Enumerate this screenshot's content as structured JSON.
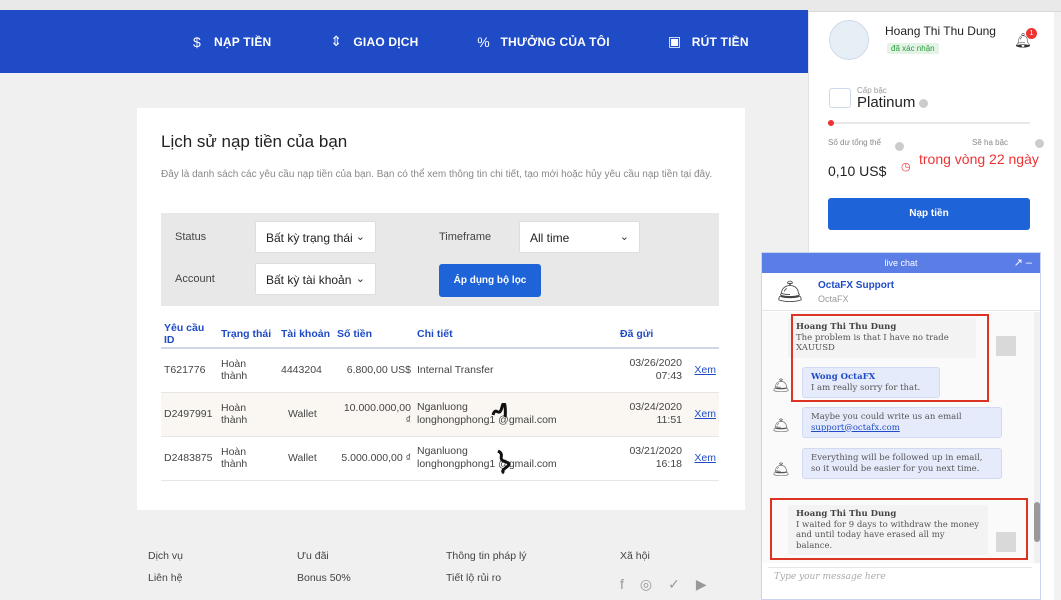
{
  "nav": {
    "items": [
      {
        "icon": "dollar-icon",
        "glyph": "$",
        "label": "NẠP TIỀN"
      },
      {
        "icon": "exchange-icon",
        "glyph": "⇕",
        "label": "GIAO DỊCH"
      },
      {
        "icon": "percent-icon",
        "glyph": "%",
        "label": "THƯỞNG CỦA TÔI"
      },
      {
        "icon": "withdraw-icon",
        "glyph": "▣",
        "label": "RÚT TIỀN"
      }
    ]
  },
  "history": {
    "title": "Lịch sử nạp tiền của bạn",
    "description": "Đây là danh sách các yêu cầu nạp tiền của bạn. Bạn có thể xem thông tin chi tiết, tạo mới hoặc hủy yêu cầu nạp tiền tại đây.",
    "filters": {
      "status_label": "Status",
      "status_value": "Bất kỳ trạng thái",
      "timeframe_label": "Timeframe",
      "timeframe_value": "All time",
      "account_label": "Account",
      "account_value": "Bất kỳ tài khoản",
      "apply_label": "Áp dụng bộ lọc"
    },
    "columns": [
      "Yêu cầu ID",
      "Trạng thái",
      "Tài khoản",
      "Số tiền",
      "Chi tiết",
      "Đã gửi"
    ],
    "rows": [
      {
        "id": "T621776",
        "status": "Hoàn thành",
        "account": "4443204",
        "amount": "6.800,00 US$",
        "detail1": "Internal Transfer",
        "detail2": "",
        "date": "03/26/2020",
        "time": "07:43",
        "action": "Xem"
      },
      {
        "id": "D2497991",
        "status": "Hoàn thành",
        "account": "Wallet",
        "amount": "10.000.000,00 ₫",
        "detail1": "Nganluong",
        "detail2": "longhongphong1  @gmail.com",
        "date": "03/24/2020",
        "time": "11:51",
        "action": "Xem"
      },
      {
        "id": "D2483875",
        "status": "Hoàn thành",
        "account": "Wallet",
        "amount": "5.000.000,00 ₫",
        "detail1": "Nganluong",
        "detail2": "longhongphong1  @gmail.com",
        "date": "03/21/2020",
        "time": "16:18",
        "action": "Xem"
      }
    ]
  },
  "footer": {
    "col1": [
      "Dịch vụ",
      "Liên hệ"
    ],
    "col2": [
      "Ưu đãi",
      "Bonus 50%"
    ],
    "col3": [
      "Thông tin pháp lý",
      "Tiết lộ rủi ro"
    ],
    "col4": [
      "Xã hội"
    ]
  },
  "profile": {
    "name": "Hoang Thi Thu Dung",
    "verified": "đã xác nhận",
    "notifications": "1",
    "tier_label": "Cấp bậc",
    "tier": "Platinum",
    "balance_label": "Số dư tổng thể",
    "balance": "0,10 US$",
    "expiry_label": "Sẽ hạ bậc",
    "expiry": "trong vòng 22 ngày",
    "deposit_label": "Nạp tiền"
  },
  "chat": {
    "title": "live chat",
    "agent_name": "OctaFX Support",
    "agent_company": "OctaFX",
    "input_placeholder": "Type your message here",
    "m1_name": "Hoang Thi Thu Dung",
    "m1_text": "The problem is that I have no trade XAUUSD",
    "m2_name": "Wong OctaFX",
    "m2_text": "I am really sorry for that.",
    "m3_text": "Maybe you could write us an email",
    "m3_link": "support@octafx.com",
    "m4_text": "Everything will be followed up in email, so it would be easier for you next time.",
    "m5_name": "Hoang Thi Thu Dung",
    "m5_text": "I waited for 9 days to withdraw the money and until today have erased all my balance."
  },
  "colors": {
    "nav_bg": "#1f4bc7",
    "button": "#1e63d8",
    "success": "#2a9d3a",
    "alert": "#e33"
  }
}
